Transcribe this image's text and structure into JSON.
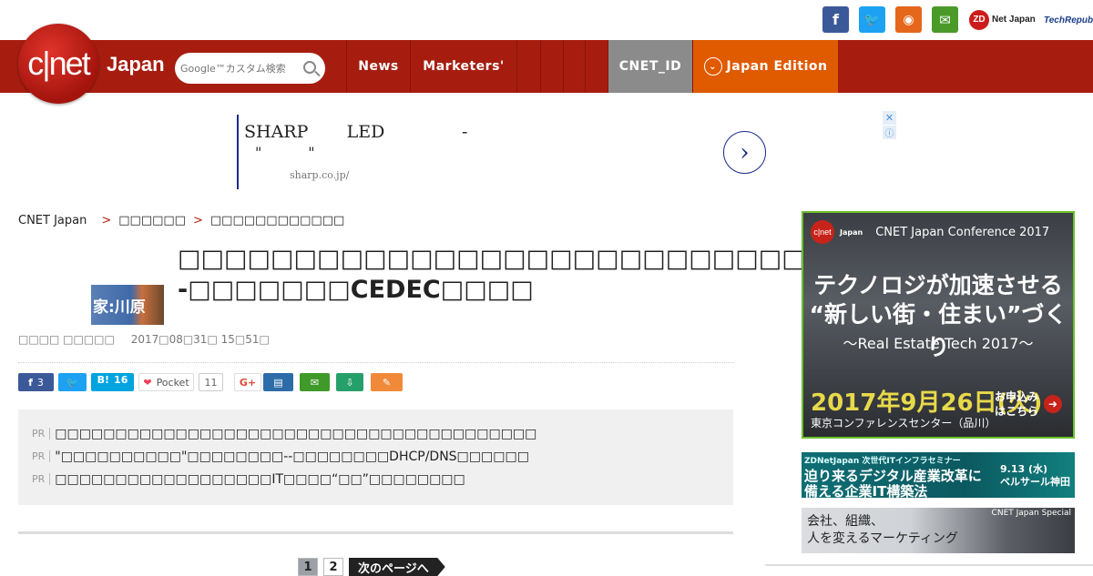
{
  "topbar": {
    "social": [
      {
        "name": "facebook-icon",
        "glyph": "f",
        "color": "#3b5998"
      },
      {
        "name": "twitter-icon",
        "glyph": "🐦",
        "color": "#1da1f2"
      },
      {
        "name": "rss-icon",
        "glyph": "◉",
        "color": "#e5671b"
      },
      {
        "name": "mail-icon",
        "glyph": "✉",
        "color": "#4a9a2a"
      }
    ],
    "zdnet_label": "Net Japan",
    "zdnet_mark": "ZD",
    "techrepublic_label": "TechRepublic"
  },
  "header": {
    "logo_text": "c|net",
    "logo_sub": "Japan",
    "search_placeholder": "Google™カスタム検索",
    "nav": [
      {
        "label": "News"
      },
      {
        "label": "Marketers'"
      },
      {
        "label": ""
      },
      {
        "label": ""
      },
      {
        "label": ""
      }
    ],
    "cnet_id": "CNET_ID",
    "edition_label": "Japan Edition",
    "edition_icon": "⌄"
  },
  "ad": {
    "line1": "SHARP       LED              -",
    "line2": "\"          \"",
    "url": "sharp.co.jp/",
    "next": "›",
    "close": "✕",
    "info": "ⓘ"
  },
  "breadcrumb": {
    "items": [
      "CNET Japan",
      "□□□□□□",
      "□□□□□□□□□□□□"
    ],
    "separator": ">"
  },
  "article": {
    "thumb_text": "家:川原",
    "title": "□□□□□□□□□□□□□□□□□□□□□□□□□□□--□□□□□□□CEDEC□□□□",
    "author": "□□□□ □□□□□",
    "date": "2017□08□31□ 15□51□"
  },
  "share": {
    "facebook_count": "3",
    "hatena_label": "B!",
    "hatena_count": "16",
    "pocket_label": "Pocket",
    "pocket_count": "11",
    "gplus_label": "G+"
  },
  "pr": {
    "tag": "PR",
    "items": [
      "□□□□□□□□□□□□□□□□□□□□□□□□□□□□□□□□□□□□□□□□",
      "\"□□□□□□□□□□\"□□□□□□□□--□□□□□□□□DHCP/DNS□□□□□□",
      "□□□□□□□□□□□□□□□□□□IT□□□□“□□”□□□□□□□□"
    ]
  },
  "pager": {
    "pages": [
      "1",
      "2"
    ],
    "next_label": "次のページへ"
  },
  "sidebar": {
    "conf_logo": "c|net",
    "conf_logo_jp": "Japan",
    "conf_title": "CNET Japan Conference 2017",
    "conf_headline1": "テクノロジが加速させる",
    "conf_headline2": "“新しい街・住まい”づくり",
    "conf_sub": "～Real Estate Tech 2017～",
    "conf_date": "2017年9月26日(火)",
    "conf_venue": "東京コンファレンスセンター（品川）",
    "conf_apply": "お申込み\nはこちら",
    "seminar_tag": "ZDNetJapan 次世代ITインフラセミナー",
    "seminar_line1": "迫り来るデジタル産業改革に",
    "seminar_line2": "備える企業IT構築法",
    "seminar_date": "9.13 (水)",
    "seminar_place": "ベルサール神田",
    "special_tag": "CNET Japan Special",
    "special_text": "会社、組織、\n人を変えるマーケティング"
  }
}
